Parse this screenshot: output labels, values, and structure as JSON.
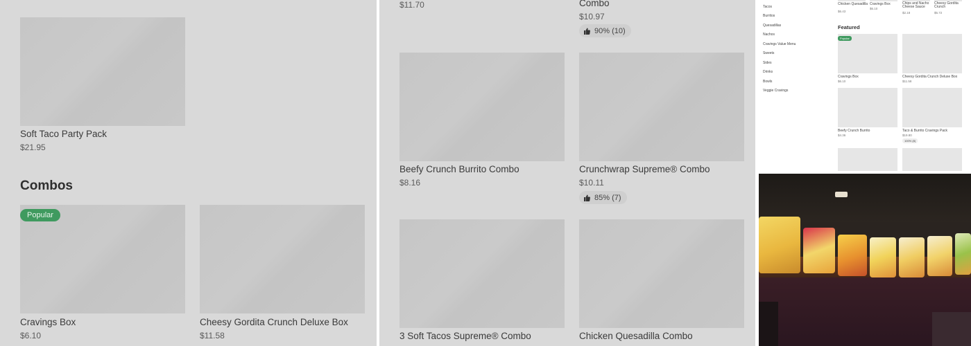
{
  "panel1": {
    "top_prices": [
      "",
      ""
    ],
    "soft_taco": {
      "name": "Soft Taco Party Pack",
      "price": "$21.95"
    },
    "combos_title": "Combos",
    "cravings_box": {
      "badge": "Popular",
      "name": "Cravings Box",
      "price": "$6.10"
    },
    "cheesy_gordita": {
      "name": "Cheesy Gordita Crunch Deluxe Box",
      "price": "$11.58"
    }
  },
  "panel2": {
    "top_left_price": "$11.70",
    "top_right_name": "Combo",
    "top_right_price": "$10.97",
    "top_right_rating": "90% (10)",
    "beefy": {
      "name": "Beefy Crunch Burrito Combo",
      "price": "$8.16"
    },
    "crunchwrap": {
      "name": "Crunchwrap Supreme® Combo",
      "price": "$10.11",
      "rating": "85% (7)"
    },
    "soft_tacos": {
      "name": "3 Soft Tacos Supreme® Combo"
    },
    "quesadilla": {
      "name": "Chicken Quesadilla Combo"
    }
  },
  "panel3": {
    "sidebar": [
      "Tacos",
      "Burritos",
      "Quesadillas",
      "Nachos",
      "Cravings Value Menu",
      "Sweets",
      "Sides",
      "Drinks",
      "Bowls",
      "Veggie Cravings"
    ],
    "top_items": [
      {
        "name": "Chicken Quesadilla",
        "price": "$6.43"
      },
      {
        "name": "Cravings Box",
        "price": "$6.10"
      },
      {
        "name": "Chips and Nacho Cheese Sauce",
        "price": "$2.18"
      },
      {
        "name": "Cheesy Gordita Crunch",
        "price": "$5.72"
      }
    ],
    "featured_title": "Featured",
    "featured_badge": "Popular",
    "featured": [
      {
        "name": "Cravings Box",
        "price": "$6.10"
      },
      {
        "name": "Cheesy Gordita Crunch Deluxe Box",
        "price": "$11.58"
      },
      {
        "name": "Beefy Crunch Burrito",
        "price": "$4.36"
      },
      {
        "name": "Taco & Burrito Cravings Pack",
        "price": "$19.80",
        "rating": "100% (8)"
      }
    ]
  },
  "colors": {
    "badge_green": "#3f9a5f",
    "panel_gray": "#d9d9d9"
  }
}
